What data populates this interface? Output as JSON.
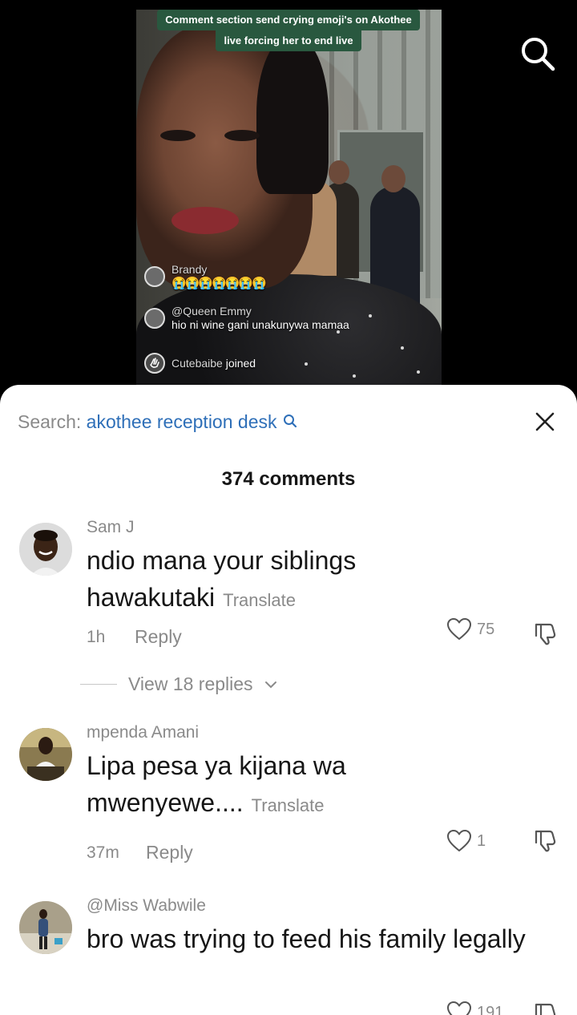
{
  "video": {
    "caption_line1": "Comment section send crying emoji's on Akothee",
    "caption_line2": "live forcing her to end live",
    "live_comments": [
      {
        "name": "Brandy",
        "text": "😭😭😭😭😭😭😭"
      },
      {
        "name": "@Queen Emmy",
        "text": "hio ni wine gani unakunywa mamaa"
      },
      {
        "name": "Cutebaibe",
        "text": "joined"
      }
    ]
  },
  "sheet": {
    "search_prefix": "Search:",
    "search_term": "akothee reception desk",
    "comments_count": "374 comments"
  },
  "comments": [
    {
      "username": "Sam J",
      "text": "ndio mana your siblings hawakutaki",
      "translate": "Translate",
      "time": "1h",
      "reply": "Reply",
      "likes": "75",
      "view_replies": "View 18 replies"
    },
    {
      "username": "mpenda Amani",
      "text": "Lipa pesa ya kijana wa mwenyewe....",
      "translate": "Translate",
      "time": "37m",
      "reply": "Reply",
      "likes": "1"
    },
    {
      "username": "@Miss Wabwile",
      "text": "bro was trying to feed his family legally",
      "likes": "191"
    }
  ],
  "colors": {
    "search_term": "#2e6fb8",
    "caption_bg": "#29583f",
    "secondary_text": "#8a8a8a"
  },
  "icons": [
    "search-icon",
    "close-icon",
    "heart-icon",
    "dislike-icon",
    "chevron-down-icon",
    "wave-icon"
  ]
}
